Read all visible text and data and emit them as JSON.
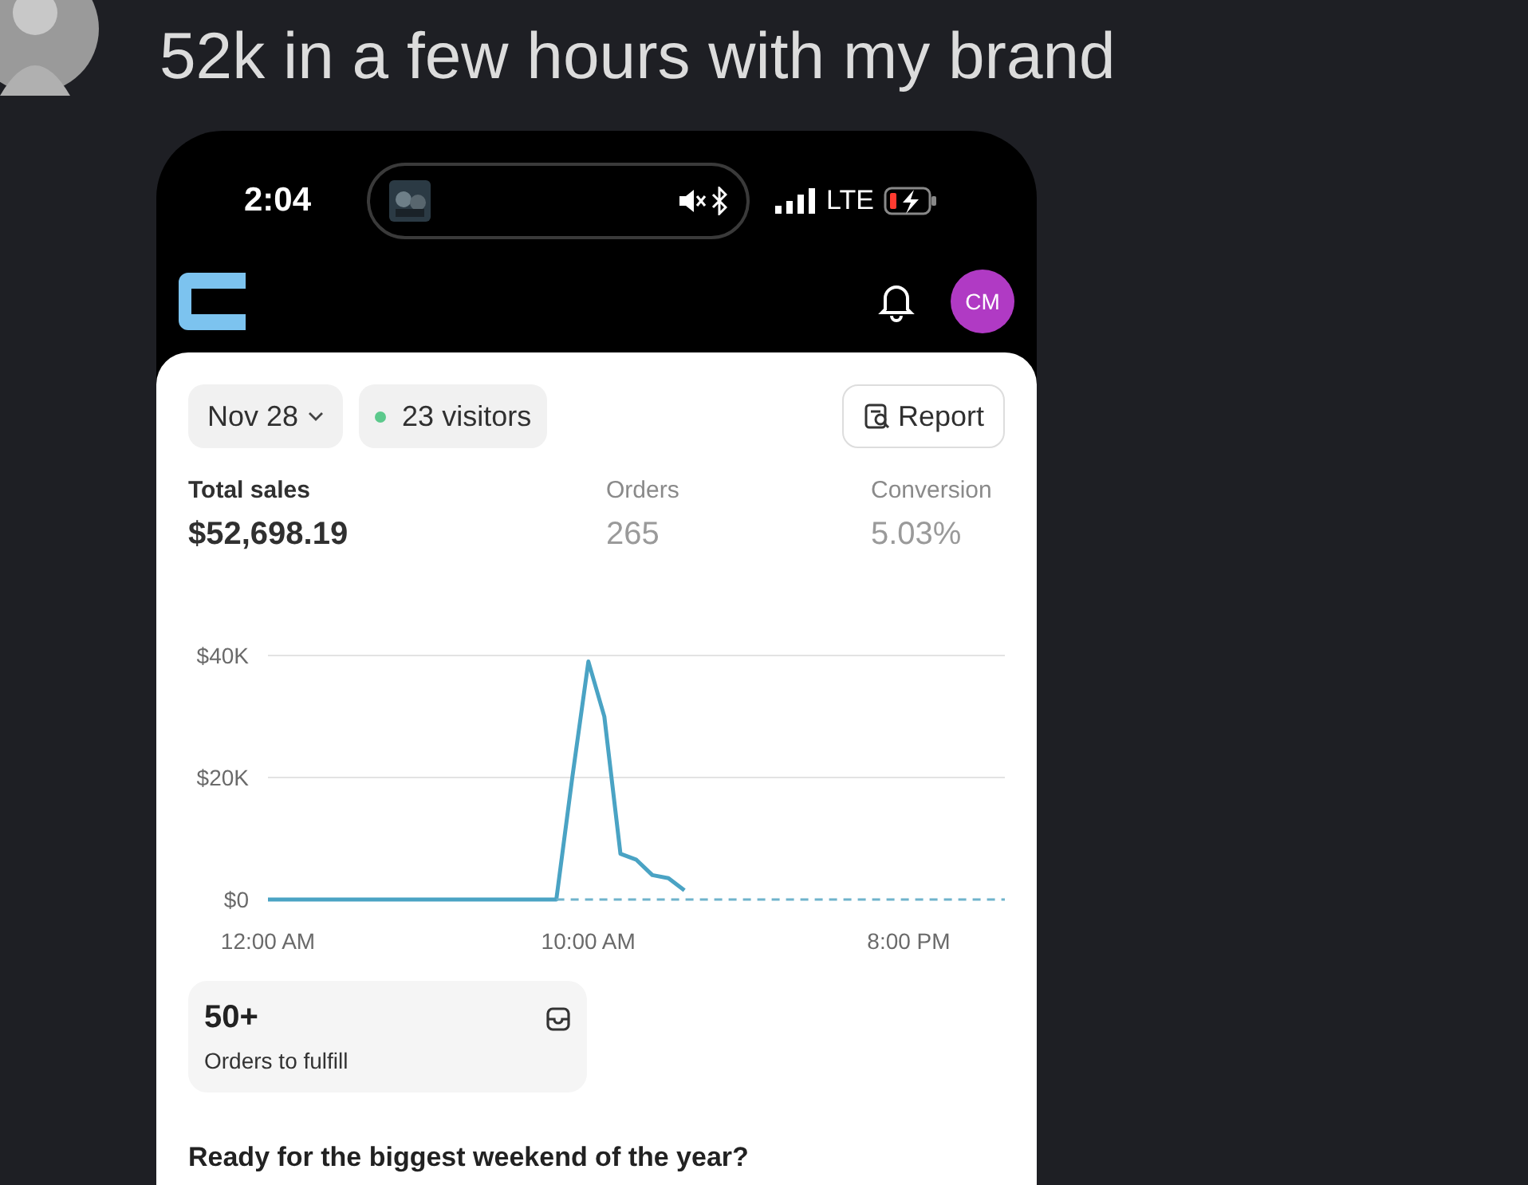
{
  "post": {
    "text": "52k in a few hours with my brand"
  },
  "status_bar": {
    "time": "2:04",
    "network": "LTE"
  },
  "app_header": {
    "avatar_initials": "CM"
  },
  "filters": {
    "date": "Nov 28",
    "visitors": "23 visitors",
    "report_button": "Report"
  },
  "metrics": [
    {
      "label": "Total sales",
      "value": "$52,698.19",
      "selected": true
    },
    {
      "label": "Orders",
      "value": "265",
      "selected": false
    },
    {
      "label": "Conversion",
      "value": "5.03%",
      "selected": false
    }
  ],
  "chart_data": {
    "type": "line",
    "x": [
      0,
      1,
      2,
      3,
      4,
      5,
      6,
      7,
      8,
      9,
      9.5,
      10,
      10.5,
      11,
      11.5,
      12,
      12.5,
      13,
      14,
      15,
      16,
      17,
      18,
      19,
      20,
      21,
      22,
      23
    ],
    "xticks": [
      {
        "value": 0,
        "label": "12:00 AM"
      },
      {
        "value": 10,
        "label": "10:00 AM"
      },
      {
        "value": 20,
        "label": "8:00 PM"
      }
    ],
    "yticks": [
      {
        "value": 0,
        "label": "$0"
      },
      {
        "value": 20000,
        "label": "$20K"
      },
      {
        "value": 40000,
        "label": "$40K"
      }
    ],
    "xlim": [
      0,
      23
    ],
    "ylim": [
      0,
      40000
    ],
    "series": [
      {
        "color": "#4aa3c4",
        "line_style": "solid",
        "values": [
          0,
          0,
          0,
          0,
          0,
          0,
          0,
          0,
          0,
          0,
          20000,
          39000,
          30000,
          7500,
          6500,
          4000,
          3500,
          1500,
          null,
          null,
          null,
          null,
          null,
          null,
          null,
          null,
          null,
          null
        ]
      },
      {
        "color": "#6fb3cc",
        "line_style": "dashed",
        "values": [
          null,
          null,
          null,
          null,
          null,
          null,
          null,
          null,
          null,
          0,
          0,
          0,
          0,
          0,
          0,
          0,
          0,
          0,
          0,
          0,
          0,
          0,
          0,
          0,
          0,
          0,
          0,
          0
        ]
      }
    ]
  },
  "fulfill_card": {
    "count": "50+",
    "label": "Orders to fulfill"
  },
  "banner": {
    "text": "Ready for the biggest weekend of the year?"
  }
}
